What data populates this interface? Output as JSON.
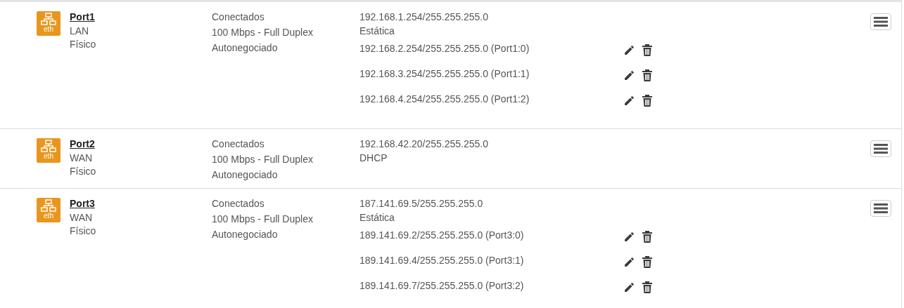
{
  "interfaces": [
    {
      "icon_label": "eth",
      "name": "Port1",
      "zone": "LAN",
      "type": "Físico",
      "status": [
        "Conectados",
        "100 Mbps - Full Duplex",
        "Autonegociado"
      ],
      "ip": "192.168.1.254/255.255.255.0",
      "mode": "Estática",
      "aliases": [
        "192.168.2.254/255.255.255.0 (Port1:0)",
        "192.168.3.254/255.255.255.0 (Port1:1)",
        "192.168.4.254/255.255.255.0 (Port1:2)"
      ]
    },
    {
      "icon_label": "eth",
      "name": "Port2",
      "zone": "WAN",
      "type": "Físico",
      "status": [
        "Conectados",
        "100 Mbps - Full Duplex",
        "Autonegociado"
      ],
      "ip": "192.168.42.20/255.255.255.0",
      "mode": "DHCP"
    },
    {
      "icon_label": "eth",
      "name": "Port3",
      "zone": "WAN",
      "type": "Físico",
      "status": [
        "Conectados",
        "100 Mbps - Full Duplex",
        "Autonegociado"
      ],
      "ip": "187.141.69.5/255.255.255.0",
      "mode": "Estática",
      "aliases": [
        "189.141.69.2/255.255.255.0 (Port3:0)",
        "189.141.69.4/255.255.255.0 (Port3:1)",
        "189.141.69.7/255.255.255.0 (Port3:2)"
      ]
    }
  ]
}
